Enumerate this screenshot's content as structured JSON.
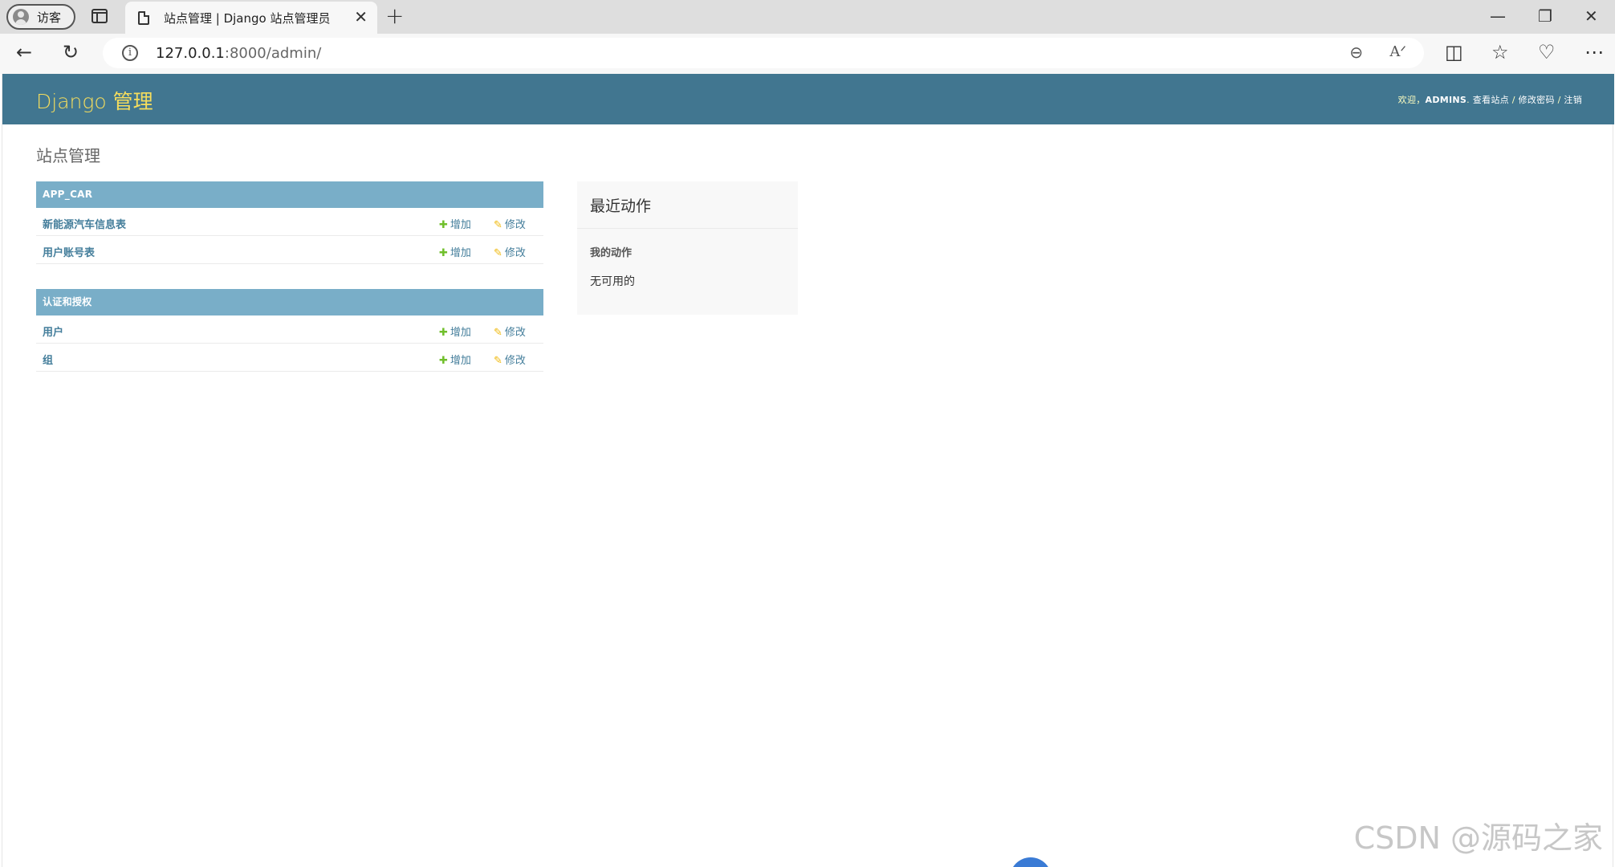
{
  "browser": {
    "profile_label": "访客",
    "tab_title": "站点管理 | Django 站点管理员",
    "url_host": "127.0.0.1",
    "url_path": ":8000/admin/"
  },
  "header": {
    "branding": "Django 管理",
    "welcome": "欢迎，",
    "username": "ADMINS",
    "view_site": "查看站点",
    "change_password": "修改密码",
    "logout": "注销",
    "separator": " / "
  },
  "content": {
    "title": "站点管理"
  },
  "modules": [
    {
      "caption": "APP_CAR",
      "models": [
        {
          "name": "新能源汽车信息表",
          "add": "增加",
          "change": "修改"
        },
        {
          "name": "用户账号表",
          "add": "增加",
          "change": "修改"
        }
      ]
    },
    {
      "caption": "认证和授权",
      "models": [
        {
          "name": "用户",
          "add": "增加",
          "change": "修改"
        },
        {
          "name": "组",
          "add": "增加",
          "change": "修改"
        }
      ]
    }
  ],
  "recent_actions": {
    "title": "最近动作",
    "subtitle": "我的动作",
    "empty": "无可用的"
  },
  "watermark": "CSDN @源码之家",
  "colors": {
    "header_bg": "#417690",
    "branding": "#f5dd5d",
    "caption_bg": "#79aec8",
    "link": "#447e9b",
    "add_icon": "#70bf2b",
    "change_icon": "#efb80b"
  }
}
